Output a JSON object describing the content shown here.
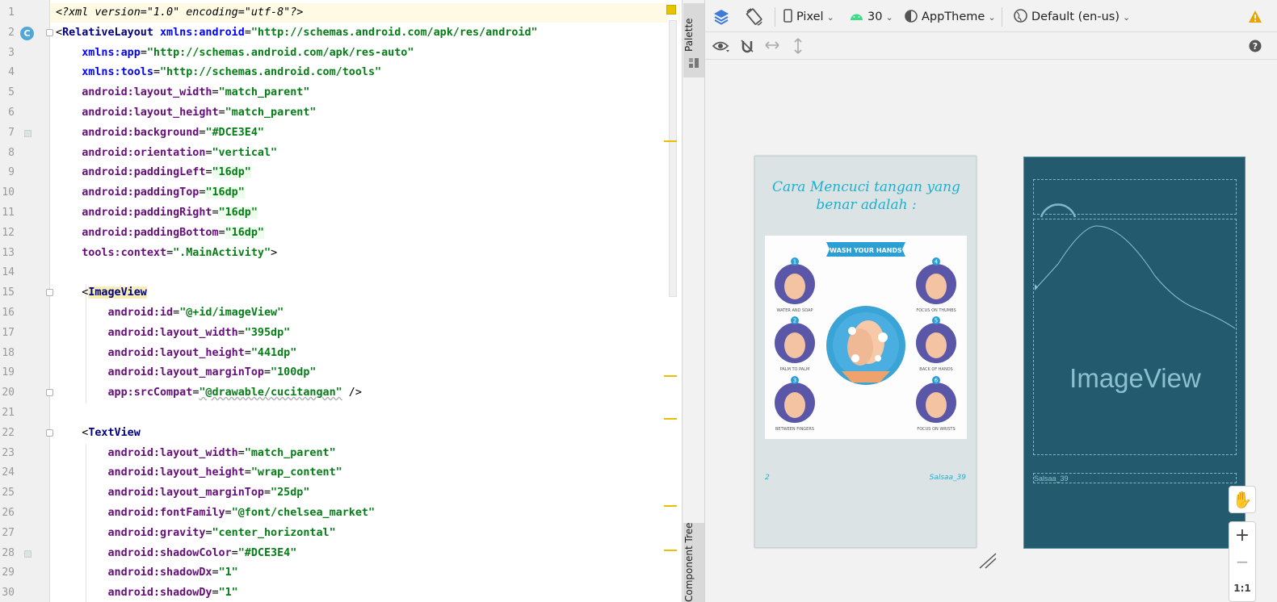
{
  "editor": {
    "lines": [
      {
        "n": "1",
        "tokens": [
          [
            "pi",
            "<?xml version=\"1.0\" encoding=\"utf-8\"?>"
          ]
        ]
      },
      {
        "n": "2",
        "tokens": [
          [
            "plain",
            "<"
          ],
          [
            "tag",
            "RelativeLayout"
          ],
          [
            "plain",
            " "
          ],
          [
            "ns",
            "xmlns:android"
          ],
          [
            "plain",
            "="
          ],
          [
            "val",
            "\"http://schemas.android.com/apk/res/android\""
          ]
        ]
      },
      {
        "n": "3",
        "tokens": [
          [
            "plain",
            "    "
          ],
          [
            "ns",
            "xmlns:app"
          ],
          [
            "plain",
            "="
          ],
          [
            "val",
            "\"http://schemas.android.com/apk/res-auto\""
          ]
        ]
      },
      {
        "n": "4",
        "tokens": [
          [
            "plain",
            "    "
          ],
          [
            "ns",
            "xmlns:tools"
          ],
          [
            "plain",
            "="
          ],
          [
            "val",
            "\"http://schemas.android.com/tools\""
          ]
        ]
      },
      {
        "n": "5",
        "tokens": [
          [
            "plain",
            "    "
          ],
          [
            "attr",
            "android:layout_width"
          ],
          [
            "plain",
            "="
          ],
          [
            "val",
            "\"match_parent\""
          ]
        ]
      },
      {
        "n": "6",
        "tokens": [
          [
            "plain",
            "    "
          ],
          [
            "attr",
            "android:layout_height"
          ],
          [
            "plain",
            "="
          ],
          [
            "val",
            "\"match_parent\""
          ]
        ]
      },
      {
        "n": "7",
        "tokens": [
          [
            "plain",
            "    "
          ],
          [
            "attr",
            "android:background"
          ],
          [
            "plain",
            "="
          ],
          [
            "val",
            "\"#DCE3E4\""
          ]
        ]
      },
      {
        "n": "8",
        "tokens": [
          [
            "plain",
            "    "
          ],
          [
            "attr",
            "android:orientation"
          ],
          [
            "plain",
            "="
          ],
          [
            "val",
            "\"vertical\""
          ]
        ]
      },
      {
        "n": "9",
        "tokens": [
          [
            "plain",
            "    "
          ],
          [
            "attr",
            "android:paddingLeft"
          ],
          [
            "plain",
            "="
          ],
          [
            "valhl",
            "\"16dp\""
          ]
        ]
      },
      {
        "n": "10",
        "tokens": [
          [
            "plain",
            "    "
          ],
          [
            "attr",
            "android:paddingTop"
          ],
          [
            "plain",
            "="
          ],
          [
            "valhl",
            "\"16dp\""
          ]
        ]
      },
      {
        "n": "11",
        "tokens": [
          [
            "plain",
            "    "
          ],
          [
            "attr",
            "android:paddingRight"
          ],
          [
            "plain",
            "="
          ],
          [
            "valhl",
            "\"16dp\""
          ]
        ]
      },
      {
        "n": "12",
        "tokens": [
          [
            "plain",
            "    "
          ],
          [
            "attr",
            "android:paddingBottom"
          ],
          [
            "plain",
            "="
          ],
          [
            "valhl",
            "\"16dp\""
          ]
        ]
      },
      {
        "n": "13",
        "tokens": [
          [
            "plain",
            "    "
          ],
          [
            "attr",
            "tools:context"
          ],
          [
            "plain",
            "="
          ],
          [
            "val",
            "\".MainActivity\""
          ],
          [
            "plain",
            ">"
          ]
        ]
      },
      {
        "n": "14",
        "tokens": []
      },
      {
        "n": "15",
        "tokens": [
          [
            "plain",
            "    <"
          ],
          [
            "taghl",
            "ImageView"
          ]
        ]
      },
      {
        "n": "16",
        "tokens": [
          [
            "plain",
            "        "
          ],
          [
            "attr",
            "android:id"
          ],
          [
            "plain",
            "="
          ],
          [
            "val",
            "\"@+id/imageView\""
          ]
        ]
      },
      {
        "n": "17",
        "tokens": [
          [
            "plain",
            "        "
          ],
          [
            "attr",
            "android:layout_width"
          ],
          [
            "plain",
            "="
          ],
          [
            "val",
            "\"395dp\""
          ]
        ]
      },
      {
        "n": "18",
        "tokens": [
          [
            "plain",
            "        "
          ],
          [
            "attr",
            "android:layout_height"
          ],
          [
            "plain",
            "="
          ],
          [
            "val",
            "\"441dp\""
          ]
        ]
      },
      {
        "n": "19",
        "tokens": [
          [
            "plain",
            "        "
          ],
          [
            "attr",
            "android:layout_marginTop"
          ],
          [
            "plain",
            "="
          ],
          [
            "val",
            "\"100dp\""
          ]
        ]
      },
      {
        "n": "20",
        "tokens": [
          [
            "plain",
            "        "
          ],
          [
            "attr",
            "app:srcCompat"
          ],
          [
            "plain",
            "="
          ],
          [
            "valsq",
            "\"@drawable/cucitangan\""
          ],
          [
            "plain",
            " />"
          ]
        ]
      },
      {
        "n": "21",
        "tokens": []
      },
      {
        "n": "22",
        "tokens": [
          [
            "plain",
            "    <"
          ],
          [
            "tag",
            "TextView"
          ]
        ]
      },
      {
        "n": "23",
        "tokens": [
          [
            "plain",
            "        "
          ],
          [
            "attr",
            "android:layout_width"
          ],
          [
            "plain",
            "="
          ],
          [
            "val",
            "\"match_parent\""
          ]
        ]
      },
      {
        "n": "24",
        "tokens": [
          [
            "plain",
            "        "
          ],
          [
            "attr",
            "android:layout_height"
          ],
          [
            "plain",
            "="
          ],
          [
            "val",
            "\"wrap_content\""
          ]
        ]
      },
      {
        "n": "25",
        "tokens": [
          [
            "plain",
            "        "
          ],
          [
            "attr",
            "android:layout_marginTop"
          ],
          [
            "plain",
            "="
          ],
          [
            "val",
            "\"25dp\""
          ]
        ]
      },
      {
        "n": "26",
        "tokens": [
          [
            "plain",
            "        "
          ],
          [
            "attr",
            "android:fontFamily"
          ],
          [
            "plain",
            "="
          ],
          [
            "val",
            "\"@font/chelsea_market\""
          ]
        ]
      },
      {
        "n": "27",
        "tokens": [
          [
            "plain",
            "        "
          ],
          [
            "attr",
            "android:gravity"
          ],
          [
            "plain",
            "="
          ],
          [
            "val",
            "\"center_horizontal\""
          ]
        ]
      },
      {
        "n": "28",
        "tokens": [
          [
            "plain",
            "        "
          ],
          [
            "attr",
            "android:shadowColor"
          ],
          [
            "plain",
            "="
          ],
          [
            "val",
            "\"#DCE3E4\""
          ]
        ]
      },
      {
        "n": "29",
        "tokens": [
          [
            "plain",
            "        "
          ],
          [
            "attr",
            "android:shadowDx"
          ],
          [
            "plain",
            "="
          ],
          [
            "val",
            "\"1\""
          ]
        ]
      },
      {
        "n": "30",
        "tokens": [
          [
            "plain",
            "        "
          ],
          [
            "attr",
            "android:shadowDy"
          ],
          [
            "plain",
            "="
          ],
          [
            "val",
            "\"1\""
          ]
        ]
      }
    ],
    "gutter_badge": "C",
    "colors": {
      "swatch": "#DCE3E4",
      "warning": "#e8c400"
    }
  },
  "side_tabs": {
    "palette": "Palette",
    "component_tree": "Component Tree"
  },
  "toolbar": {
    "device": "Pixel",
    "api": "30",
    "theme": "AppTheme",
    "locale": "Default (en-us)",
    "icons": [
      "layers-icon",
      "orientation-icon",
      "phone-icon",
      "android-icon",
      "theme-icon",
      "globe-icon",
      "warning-icon",
      "eye-icon",
      "magnet-icon",
      "horizontal-arrows-icon",
      "vertical-arrows-icon",
      "help-icon"
    ]
  },
  "preview": {
    "title": "Cara Mencuci tangan yang benar adalah :",
    "image_heading": "WASH YOUR HANDS",
    "steps": [
      {
        "num": "1",
        "label": "WATER AND SOAP"
      },
      {
        "num": "2",
        "label": "PALM TO PALM"
      },
      {
        "num": "3",
        "label": "BETWEEN FINGERS"
      },
      {
        "num": "4",
        "label": "FOCUS ON THUMBS"
      },
      {
        "num": "5",
        "label": "BACK OF HANDS"
      },
      {
        "num": "6",
        "label": "FOCUS ON WRISTS"
      }
    ],
    "footer_left": "2",
    "footer_right": "Salsaa_39",
    "colors": {
      "background": "#DCE3E4",
      "text": "#1cb0d0"
    }
  },
  "blueprint": {
    "label": "ImageView",
    "text": "Salsaa_39",
    "colors": {
      "background": "#235a6d",
      "outline": "#7fb8c8"
    }
  },
  "controls": {
    "zoom_in": "+",
    "zoom_out": "−",
    "fit": "1:1"
  }
}
